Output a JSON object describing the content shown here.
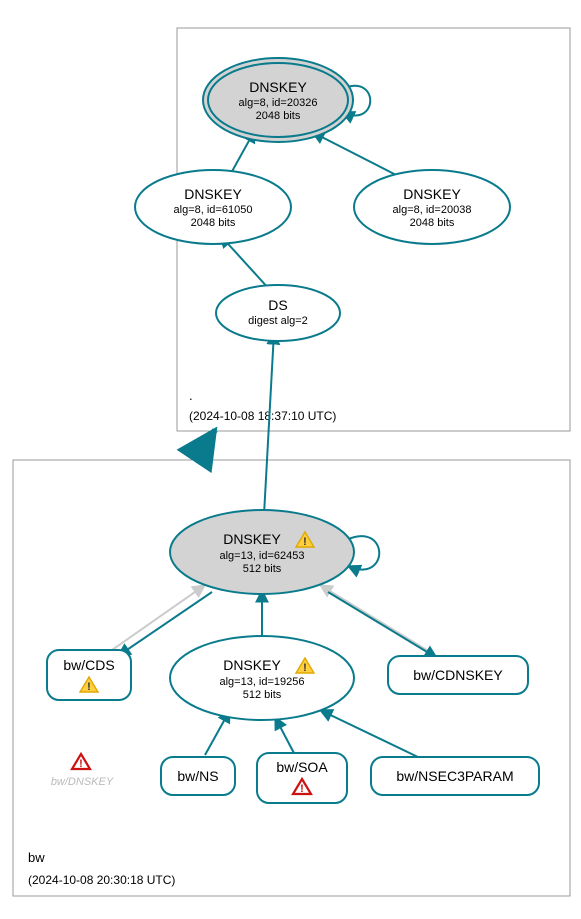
{
  "colors": {
    "teal": "#0a7b8c",
    "grey_fill": "#d3d3d3",
    "light_edge": "#cccccc"
  },
  "zones": {
    "root": {
      "label": ".",
      "timestamp": "(2024-10-08 18:37:10 UTC)"
    },
    "bw": {
      "label": "bw",
      "timestamp": "(2024-10-08 20:30:18 UTC)"
    }
  },
  "nodes": {
    "root_ksk": {
      "title": "DNSKEY",
      "line2": "alg=8, id=20326",
      "line3": "2048 bits",
      "warn": false
    },
    "root_zsk1": {
      "title": "DNSKEY",
      "line2": "alg=8, id=61050",
      "line3": "2048 bits",
      "warn": false
    },
    "root_zsk2": {
      "title": "DNSKEY",
      "line2": "alg=8, id=20038",
      "line3": "2048 bits",
      "warn": false
    },
    "root_ds": {
      "title": "DS",
      "line2": "digest alg=2",
      "line3": "",
      "warn": false
    },
    "bw_ksk": {
      "title": "DNSKEY",
      "line2": "alg=13, id=62453",
      "line3": "512 bits",
      "warn": true
    },
    "bw_zsk": {
      "title": "DNSKEY",
      "line2": "alg=13, id=19256",
      "line3": "512 bits",
      "warn": true
    },
    "bw_cds": {
      "title": "bw/CDS",
      "warn": true
    },
    "bw_cdnskey": {
      "title": "bw/CDNSKEY",
      "warn": false
    },
    "bw_ns": {
      "title": "bw/NS",
      "warn": false
    },
    "bw_soa": {
      "title": "bw/SOA",
      "warn": true,
      "warn_type": "error"
    },
    "bw_nsec3": {
      "title": "bw/NSEC3PARAM",
      "warn": false
    },
    "bw_dnskey_ghost": {
      "title": "bw/DNSKEY",
      "warn": true,
      "warn_type": "error"
    }
  },
  "icons": {
    "warn_yellow": "⚠",
    "warn_red": "⚠"
  }
}
